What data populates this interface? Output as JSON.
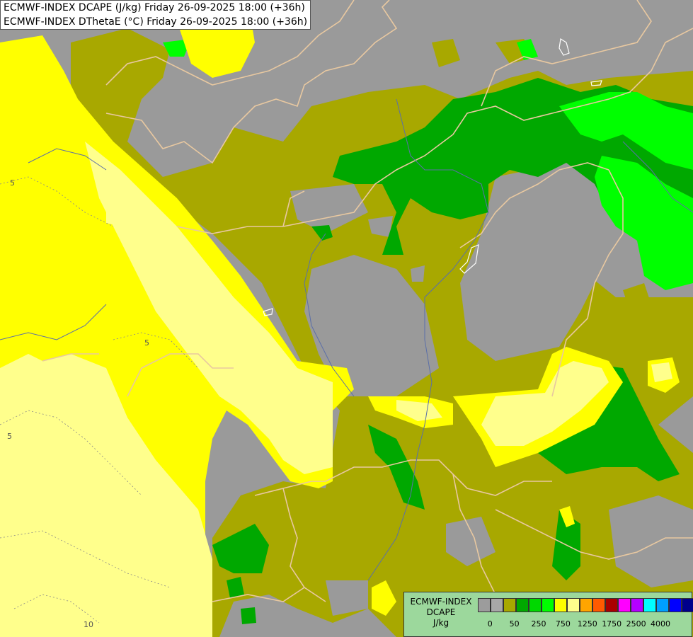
{
  "title": {
    "line1": "ECMWF-INDEX DCAPE (J/kg) Friday 26-09-2025 18:00 (+36h)",
    "line2": "ECMWF-INDEX DThetaE (°C) Friday 26-09-2025 18:00 (+36h)"
  },
  "legend": {
    "model": "ECMWF-INDEX",
    "parameter": "DCAPE",
    "unit": "J/kg",
    "swatch_colors": [
      "#9c9c9c",
      "#a8a8a8",
      "#a8a800",
      "#00a800",
      "#00d800",
      "#00ff00",
      "#ffff00",
      "#ffff8c",
      "#ffa500",
      "#ff5a00",
      "#aa0000",
      "#ff00ff",
      "#b400ff",
      "#00ffff",
      "#00a0ff",
      "#0000ff",
      "#00008c"
    ],
    "tick_labels": [
      "0",
      "50",
      "250",
      "750",
      "1250",
      "1750",
      "2500",
      "4000"
    ]
  },
  "contour_labels": [
    "5",
    "5",
    "5",
    "10"
  ],
  "colors": {
    "gray": "#9a9a9a",
    "olive": "#a8a800",
    "dark_green": "#00a800",
    "green": "#00ff00",
    "light_green": "#00d800",
    "yellow": "#ffff00",
    "light_yellow": "#ffff8c",
    "border": "#e8c8a0",
    "river": "#5b6fa8"
  }
}
